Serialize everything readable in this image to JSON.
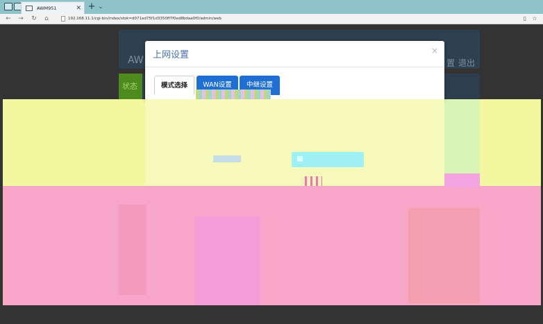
{
  "browser": {
    "tab_title": "AWM951",
    "tab_close": "✕",
    "new_tab": "+",
    "tab_dropdown": "⌄",
    "url": "192.168.11.1/cgi-bin/index/stok=d071ad75f1d3350ff7f0ed8bdaa0f0/admin/web",
    "back": "←",
    "forward": "→",
    "refresh": "↻",
    "home": "⌂",
    "reading": "▯",
    "favorite": "☆"
  },
  "page": {
    "brand": "AW",
    "header_links": [
      "置",
      "退出"
    ],
    "status": "状态"
  },
  "modal": {
    "title": "上网设置",
    "close": "×",
    "tabs": [
      "模式选择",
      "WAN设置",
      "中继设置"
    ],
    "description_lines": [
      " ",
      " ",
      " "
    ]
  },
  "colors": {
    "accent": "#1f6fd3",
    "title": "#4a72a6",
    "overlay_yellow": "#f3f7a0",
    "overlay_pink": "#f8a6c8"
  }
}
